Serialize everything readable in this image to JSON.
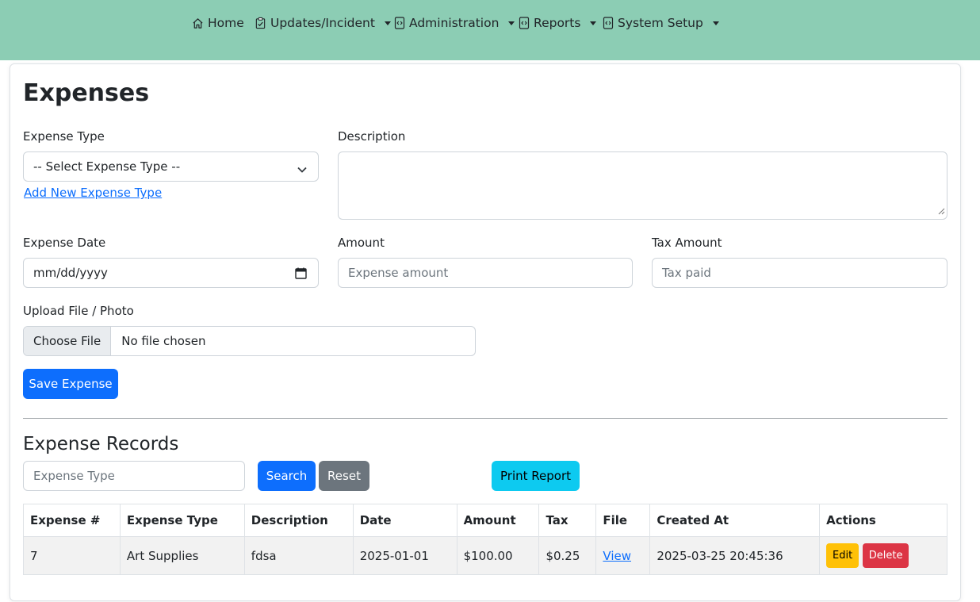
{
  "nav": {
    "items": [
      {
        "label": "Home",
        "icon": "house-icon",
        "dropdown": false
      },
      {
        "label": "Updates/Incident",
        "icon": "clipboard-check-icon",
        "dropdown": true
      },
      {
        "label": "Administration",
        "icon": "file-code-icon",
        "dropdown": true
      },
      {
        "label": "Reports",
        "icon": "file-code-icon",
        "dropdown": true
      },
      {
        "label": "System Setup",
        "icon": "file-code-icon",
        "dropdown": true
      }
    ],
    "background": "#8ccdb4"
  },
  "page": {
    "title": "Expenses"
  },
  "form": {
    "expense_type_label": "Expense Type",
    "expense_type_selected": "-- Select Expense Type --",
    "add_type_link": "Add New Expense Type",
    "description_label": "Description",
    "description_value": "",
    "date_label": "Expense Date",
    "date_placeholder": "mm/dd/yyyy",
    "amount_label": "Amount",
    "amount_placeholder": "Expense amount",
    "tax_label": "Tax Amount",
    "tax_placeholder": "Tax paid",
    "upload_label": "Upload File / Photo",
    "choose_file": "Choose File",
    "no_file": "No file chosen",
    "save_button": "Save Expense"
  },
  "records": {
    "title": "Expense Records",
    "search_placeholder": "Expense Type",
    "search_button": "Search",
    "reset_button": "Reset",
    "print_button": "Print Report",
    "columns": [
      "Expense #",
      "Expense Type",
      "Description",
      "Date",
      "Amount",
      "Tax",
      "File",
      "Created At",
      "Actions"
    ],
    "rows": [
      {
        "id": "7",
        "type": "Art Supplies",
        "description": "fdsa",
        "date": "2025-01-01",
        "amount": "$100.00",
        "tax": "$0.25",
        "file_link": "View",
        "created_at": "2025-03-25 20:45:36",
        "edit": "Edit",
        "delete": "Delete"
      }
    ]
  },
  "colors": {
    "primary": "#0d6efd",
    "secondary": "#6c757d",
    "info": "#0dcaf0",
    "warning": "#ffc107",
    "danger": "#dc3545"
  }
}
